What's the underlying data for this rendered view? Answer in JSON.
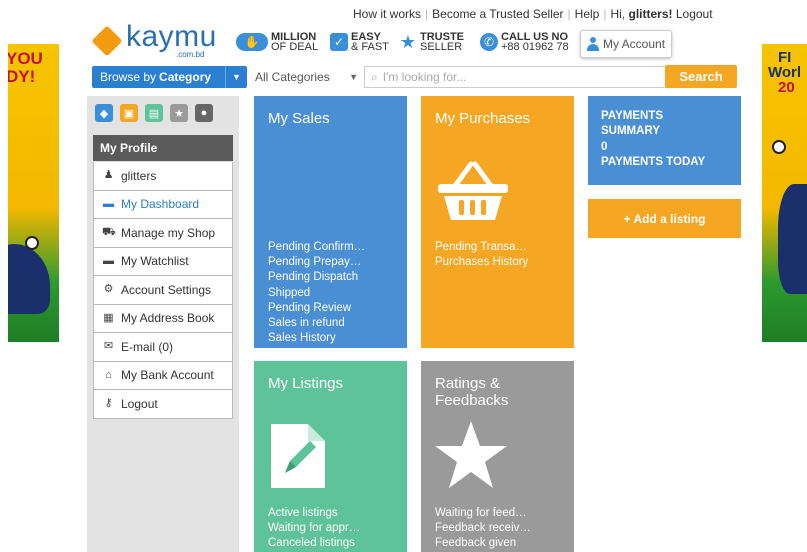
{
  "header": {
    "links": [
      "How it works",
      "Become a Trusted Seller",
      "Help",
      "Hi, ",
      "glitters!",
      "Logout"
    ],
    "logo": {
      "text": "kaymu",
      "sub": ".com.bd"
    },
    "features": [
      {
        "bold": "MILLION",
        "rest": "OF DEAL"
      },
      {
        "bold": "EASY",
        "rest": "& FAST"
      },
      {
        "bold": "TRUSTE",
        "rest": "SELLER"
      },
      {
        "bold": "CALL US NO",
        "rest": "+88 01962 78"
      }
    ],
    "my_account": "My Account"
  },
  "banners": {
    "left_text": "YOU\nDY!",
    "right_text_1": "FI",
    "right_text_2": "Worl",
    "right_text_3": "20"
  },
  "search": {
    "browse_prefix": "Browse by",
    "browse_bold": "Category",
    "category_select": "All Categories",
    "placeholder": "I'm looking for...",
    "button": "Search"
  },
  "sidebar": {
    "profile_title": "My Profile",
    "items": [
      {
        "label": "glitters",
        "icon": "user-icon"
      },
      {
        "label": "My Dashboard",
        "icon": "folder-icon"
      },
      {
        "label": "Manage my Shop",
        "icon": "cart-icon"
      },
      {
        "label": "My Watchlist",
        "icon": "folder-icon"
      },
      {
        "label": "Account Settings",
        "icon": "gear-icon"
      },
      {
        "label": "My Address Book",
        "icon": "addressbook-icon"
      },
      {
        "label": "E-mail (0)",
        "icon": "mail-icon"
      },
      {
        "label": "My Bank Account",
        "icon": "bank-icon"
      },
      {
        "label": "Logout",
        "icon": "key-icon"
      }
    ]
  },
  "tiles": {
    "sales": {
      "title": "My Sales",
      "links": [
        "Pending Confirm…",
        "Pending Prepay…",
        "Pending Dispatch",
        "Shipped",
        "Pending Review",
        "Sales in refund",
        "Sales History"
      ]
    },
    "purchases": {
      "title": "My Purchases",
      "links": [
        "Pending Transa…",
        "Purchases History"
      ]
    },
    "listings": {
      "title": "My Listings",
      "links": [
        "Active listings",
        "Waiting for appr…",
        "Canceled listings"
      ]
    },
    "ratings": {
      "title_1": "Ratings &",
      "title_2": "Feedbacks",
      "links": [
        "Waiting for feed…",
        "Feedback receiv…",
        "Feedback given"
      ]
    }
  },
  "payments": {
    "summary_1": "PAYMENTS",
    "summary_2": "SUMMARY",
    "value": "0",
    "today": "PAYMENTS TODAY"
  },
  "add_listing": "+ Add a listing",
  "colors": {
    "blue": "#4a8fd4",
    "orange": "#f5a623",
    "green": "#5ec29a",
    "gray": "#9a9a9a"
  }
}
